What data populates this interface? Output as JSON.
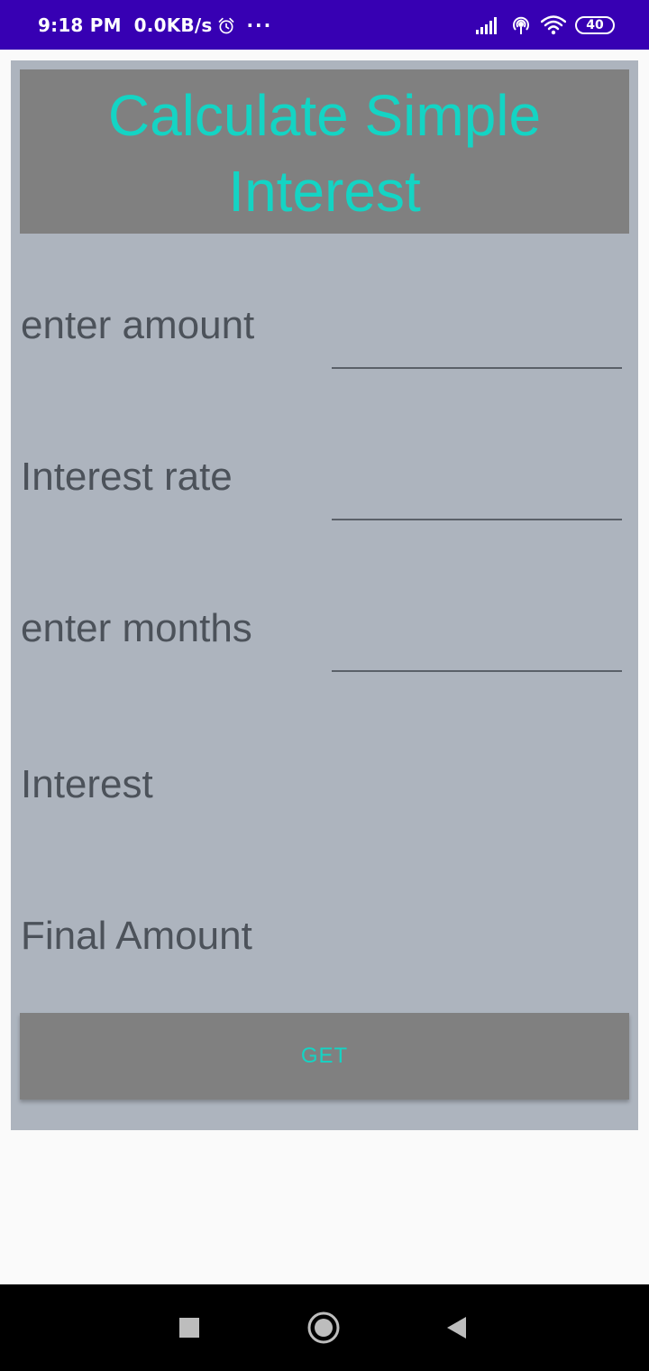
{
  "status_bar": {
    "time": "9:18 PM",
    "network_speed": "0.0KB/s",
    "overflow": "···",
    "battery_level": "40",
    "icons": [
      "alarm-icon",
      "signal-icon",
      "hotspot-icon",
      "wifi-icon",
      "battery-icon"
    ],
    "background_color": "#3700b3"
  },
  "form": {
    "title": "Calculate Simple Interest",
    "title_color": "#14d4c4",
    "fields": [
      {
        "label": "enter amount",
        "value": ""
      },
      {
        "label": "Interest rate",
        "value": ""
      },
      {
        "label": "enter months",
        "value": ""
      }
    ],
    "outputs": [
      {
        "label": "Interest"
      },
      {
        "label": "Final Amount"
      }
    ],
    "button_label": "GET"
  },
  "nav_bar": {
    "icons": [
      "recents-square-icon",
      "home-circle-icon",
      "back-triangle-icon"
    ]
  }
}
